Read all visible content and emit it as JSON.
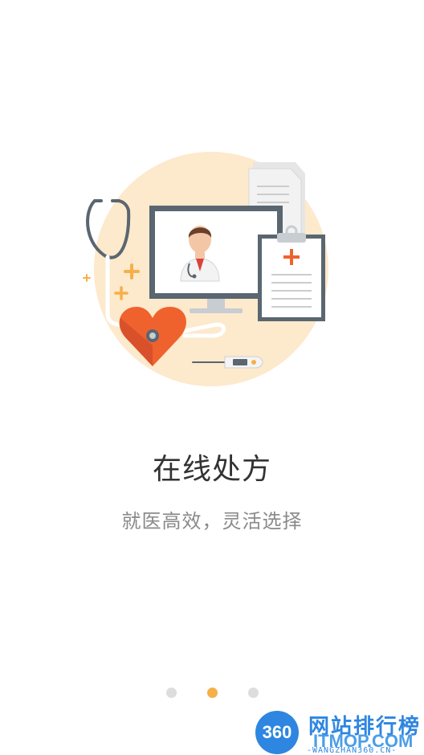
{
  "title": "在线处方",
  "subtitle": "就医高效，灵活选择",
  "pager": {
    "count": 3,
    "active_index": 1
  },
  "watermark": {
    "logo_text": "360",
    "title": "网站排行榜",
    "domain": "ITMOP.COM",
    "sub": "-WANGZHAN360.CN-"
  },
  "colors": {
    "background": "#ffffff",
    "accent": "#f5b04a",
    "dot_inactive": "#dddddd",
    "illustration_bg": "#fde9cc",
    "heart": "#f0622d",
    "cross": "#f0622d",
    "monitor_frame": "#5a6670",
    "plus_icons": "#f5b04a"
  }
}
